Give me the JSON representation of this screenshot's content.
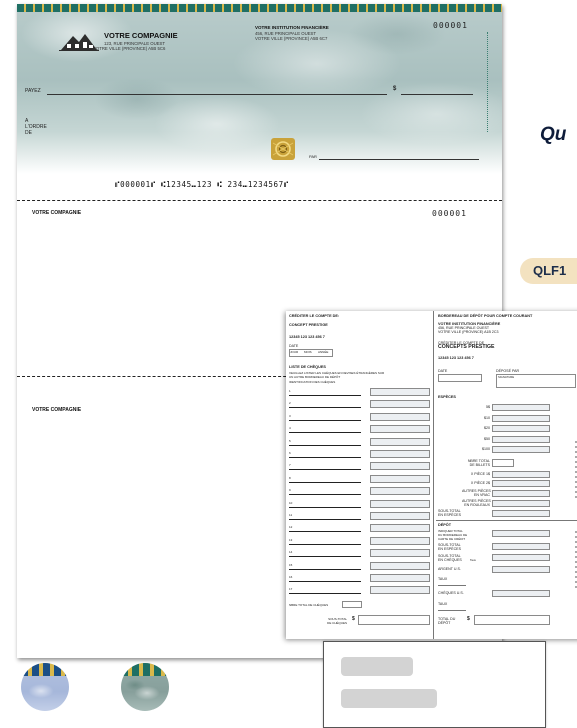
{
  "cheque": {
    "company_name": "VOTRE COMPAGNIE",
    "company_address_1": "123, RUE PRINCIPALE OUEST",
    "company_address_2": "VOTRE VILLE (PROVINCE)  A5B 5C6",
    "institution_name": "VOTRE INSTITUTION FINANCIÈRE",
    "institution_address_1": "456, RUE PRINCIPALE OUEST",
    "institution_address_2": "VOTRE VILLE (PROVINCE)  A5B 6C7",
    "number": "000001",
    "pay_label": "PAYEZ",
    "dollar_sign": "$",
    "order_label_1": "A",
    "order_label_2": "L'ORDRE",
    "order_label_3": "DE",
    "per_label": "PAR",
    "micr_line": "⑈000001⑈ ⑆12345⑉123 ⑆ 234⑉1234567⑈",
    "colors": {
      "stripe": "#1f6f64",
      "accent": "#d9b84a",
      "marble": "#a9c0bf"
    }
  },
  "stub1": {
    "company": "VOTRE COMPAGNIE",
    "number": "000001"
  },
  "stub2": {
    "company": "VOTRE COMPAGNIE"
  },
  "side": {
    "heading": "Qu",
    "product_code": "QLF1"
  },
  "slip": {
    "credit_title": "CRÉDITER LE COMPTE DE:",
    "company": "CONCEPT PRESTIGE",
    "account": "12345 123   123 456 7",
    "date_label": "DATE",
    "date_parts": [
      "JOUR",
      "MOIS",
      "ANNÉE"
    ],
    "cheque_list_title": "LISTE DE CHÈQUES",
    "cheque_list_note_1": "VEUILLEZ LISTER LES CHÈQUES EN DEVISES ÉTRANGÈRES SUR",
    "cheque_list_note_2": "UN AUTRE BORDEREAU DE DÉPÔT",
    "cheque_id_label": "IDENTIFICATION DES CHÈQUES",
    "rows": [
      "1",
      "2",
      "3",
      "4",
      "5",
      "6",
      "7",
      "8",
      "9",
      "10",
      "11",
      "12",
      "13",
      "14",
      "15",
      "16",
      "17"
    ],
    "cheque_count_label": "NBRE TOTAL DE CHÈQUES",
    "subtotal_label_1": "SOUS-TOTAL",
    "subtotal_label_2": "DE CHÈQUES",
    "dollar": "$",
    "right_title": "BORDEREAU DE DÉPÔT POUR COMPTE COURANT",
    "bank_name": "VOTRE INSTITUTION FINANCIÈRE",
    "bank_address_1": "456, RUE PRINCIPALE OUEST",
    "bank_address_2": "VOTRE VILLE (PROVINCE)  A1B 2C3",
    "credit_label": "CRÉDITER LE COMPTE DE",
    "company_big": "CONCEPTS PRESTIGE",
    "account_right": "12345 123   123 456 7",
    "deposited_by": "DÉPOSÉ PAR",
    "signature": "SIGNATURE",
    "cash_title": "ESPÈCES",
    "cash_rows": [
      "5$",
      "$10",
      "$20",
      "$50",
      "$100"
    ],
    "bills_total_1": "NBRE TOTAL",
    "bills_total_2": "DE BILLETS",
    "coins_1": "X PIÈCE 1$",
    "coins_2": "X PIÈCE 2$",
    "other_coins_1": "AUTRES PIÈCES",
    "other_coins_2": "EN VRAC",
    "other_coins_3": "AUTRES PIÈCES",
    "other_coins_4": "EN ROULEAUX",
    "cash_subtotal_1": "SOUS-TOTAL",
    "cash_subtotal_2": "EN ESPÈCES",
    "deposit_title": "DÉPÔT",
    "deposit_note_1": "INDIQUER TOTAL",
    "deposit_note_2": "DU BORDEREAU DE",
    "deposit_note_3": "CARTE DE CRÉDIT",
    "dep_subtotal_cash_1": "SOUS-TOTAL",
    "dep_subtotal_cash_2": "EN ESPÈCES",
    "dep_subtotal_chq_1": "SOUS-TOTAL",
    "dep_subtotal_chq_2": "EN CHÈQUES",
    "rate_label": "Taux",
    "us_cash": "ARGENT U.S.",
    "rate_1": "TAUX",
    "us_cheques": "CHÈQUES U.S.",
    "rate_2": "TAUX",
    "total_1": "TOTAL DU",
    "total_2": "DÉPÔT",
    "dollar_right": "$"
  }
}
